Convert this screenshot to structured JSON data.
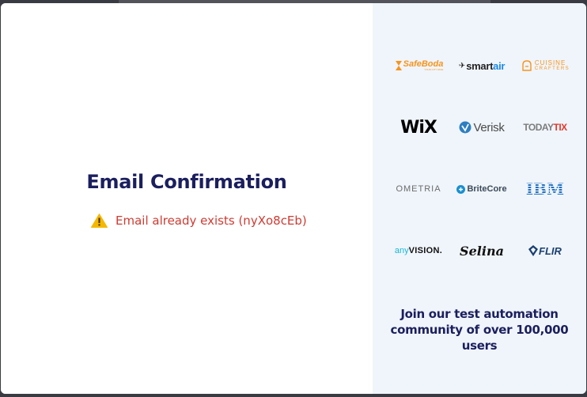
{
  "dialog": {
    "title": "Email Confirmation",
    "error_message": "Email already exists (nyXo8cEb)",
    "error_icon": "warning-icon",
    "error_color": "#cf3b32",
    "title_color": "#1b1f5e"
  },
  "logos": [
    {
      "name": "SafeBoda",
      "text": "SafeBoda",
      "sub": "YOUR CITY RIDE",
      "color": "#f7941d"
    },
    {
      "name": "smartair",
      "text": "smart",
      "text2": "air",
      "color": "#222222",
      "color2": "#1d88e5"
    },
    {
      "name": "CUISINE CRAFTERS",
      "text": "CUISINE",
      "sub": "CRAFTERS",
      "color": "#f7941d"
    },
    {
      "name": "WiX",
      "text": "WiX",
      "color": "#000000"
    },
    {
      "name": "Verisk",
      "text": "Verisk",
      "color": "#4a4a4a",
      "icon_color": "#2d7fc1"
    },
    {
      "name": "TODAYTIX",
      "text": "TODAY",
      "text2": "TIX",
      "color": "#7c7c7c",
      "color2": "#e5382b"
    },
    {
      "name": "OMETRIA",
      "text": "OMETRIA",
      "color": "#6b6b6b"
    },
    {
      "name": "BriteCore",
      "text": "BriteCore",
      "color": "#3a4a5a",
      "icon_color": "#1a8fd0"
    },
    {
      "name": "IBM",
      "text": "IBM",
      "color": "#1f70c1"
    },
    {
      "name": "anyvision",
      "text": "any",
      "text2": "VISION.",
      "color": "#19b8d6",
      "color2": "#111111"
    },
    {
      "name": "Selina",
      "text": "Selina",
      "color": "#111111"
    },
    {
      "name": "FLIR",
      "text": "FLIR",
      "color": "#1a3f6f"
    }
  ],
  "community": {
    "line1": "Join our test automation",
    "line2": "community of over 100,000 users"
  }
}
